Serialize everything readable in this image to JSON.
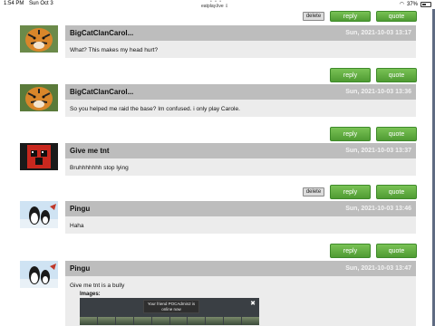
{
  "status_bar": {
    "time": "1:54 PM",
    "date": "Sun Oct 3",
    "url": "eatplay.live",
    "battery": "37%"
  },
  "posts": [
    {
      "author": "BigCatClanCarol...",
      "date": "Sun, 2021-10-03 13:17",
      "text": "What? This makes my head hurt?"
    },
    {
      "author": "BigCatClanCarol...",
      "date": "Sun, 2021-10-03 13:36",
      "text": "So you helped me raid the base? Im confused. i only play Carole."
    },
    {
      "author": "Give me tnt",
      "date": "Sun, 2021-10-03 13:37",
      "text": "Bruhhhhhhh stop lying"
    },
    {
      "author": "Pingu",
      "date": "Sun, 2021-10-03 13:46",
      "text": "Haha"
    },
    {
      "author": "Pingu",
      "date": "Sun, 2021-10-03 13:47",
      "text": "Give me tnt is a bully"
    }
  ],
  "actions": {
    "reply_label": "reply",
    "quote_label": "quote",
    "delete_label": "delete"
  },
  "images": {
    "label": "Images:",
    "toast": "Your friend POCAdmin2 is online now",
    "toast_close": "✖"
  },
  "colors": {
    "button_green": "#5ea63e",
    "header_gray": "#bdbdbd",
    "body_gray": "#ececec",
    "scrollbar": "#5f6b82"
  }
}
